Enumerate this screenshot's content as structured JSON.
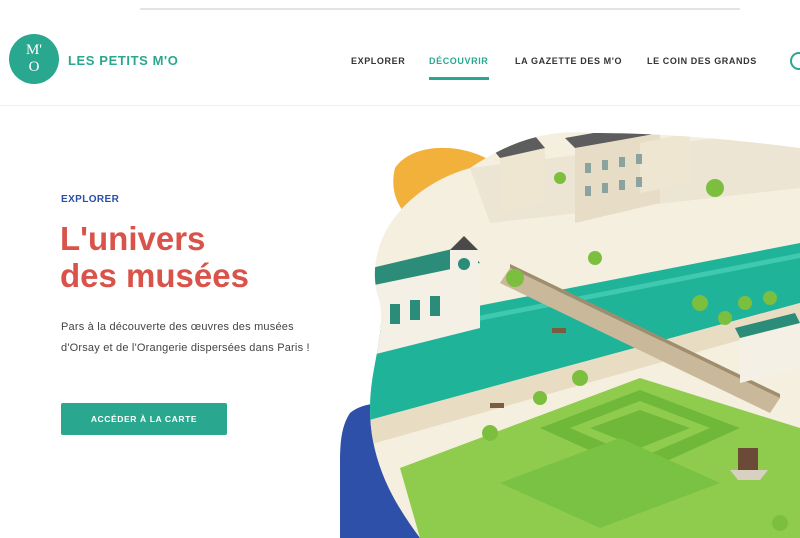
{
  "header": {
    "logo_top": "M'",
    "logo_bottom": "O",
    "brand": "LES PETITS M'O",
    "nav": [
      {
        "label": "EXPLORER"
      },
      {
        "label": "DÉCOUVRIR"
      },
      {
        "label": "LA GAZETTE DES M'O"
      },
      {
        "label": "LE COIN DES GRANDS"
      }
    ],
    "active_nav": "DÉCOUVRIR"
  },
  "hero": {
    "eyebrow": "EXPLORER",
    "title_line1": "L'univers",
    "title_line2": "des musées",
    "description": "Pars à la découverte des œuvres des musées d'Orsay et de l'Orangerie dispersées dans Paris !",
    "cta_label": "ACCÉDER À LA CARTE"
  },
  "colors": {
    "brand_green": "#2aa88f",
    "title_red": "#d9534a",
    "eyebrow_blue": "#2b4ea8",
    "blob_yellow": "#f2b13a",
    "blob_red": "#d9423d",
    "blob_blue": "#2f50a8",
    "river": "#1fb39a",
    "grass": "#7cbf3f"
  },
  "icons": [
    "logo-mark",
    "menu-circle-icon"
  ]
}
